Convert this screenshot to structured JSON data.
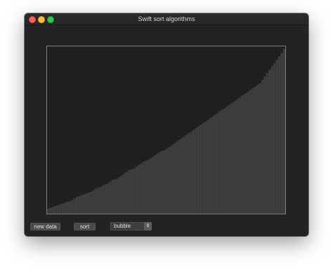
{
  "window": {
    "title": "Swift sort algorithms"
  },
  "controls": {
    "new_data_label": "new data",
    "sort_label": "sort",
    "algorithm": {
      "selected": "bubble",
      "stepper_glyph": "⇕"
    }
  },
  "colors": {
    "bar_fill": "#3d3d3d",
    "bar_edge": "#363636",
    "plot_background": "#1f1f1f",
    "plot_border": "#7d7d7d"
  },
  "chart_data": {
    "type": "bar",
    "order": "ascending",
    "bar_count": 100,
    "ylim": [
      0,
      1
    ],
    "values": [
      0.03,
      0.035,
      0.04,
      0.045,
      0.05,
      0.055,
      0.06,
      0.065,
      0.07,
      0.075,
      0.08,
      0.09,
      0.1,
      0.105,
      0.11,
      0.115,
      0.12,
      0.125,
      0.13,
      0.14,
      0.15,
      0.155,
      0.16,
      0.17,
      0.175,
      0.18,
      0.19,
      0.2,
      0.205,
      0.21,
      0.22,
      0.23,
      0.24,
      0.25,
      0.26,
      0.265,
      0.27,
      0.28,
      0.29,
      0.3,
      0.31,
      0.315,
      0.32,
      0.33,
      0.34,
      0.35,
      0.36,
      0.37,
      0.375,
      0.38,
      0.39,
      0.4,
      0.41,
      0.42,
      0.43,
      0.44,
      0.45,
      0.46,
      0.47,
      0.48,
      0.49,
      0.5,
      0.51,
      0.52,
      0.53,
      0.54,
      0.55,
      0.56,
      0.57,
      0.58,
      0.59,
      0.6,
      0.61,
      0.62,
      0.63,
      0.64,
      0.65,
      0.66,
      0.67,
      0.68,
      0.69,
      0.7,
      0.71,
      0.72,
      0.73,
      0.74,
      0.75,
      0.76,
      0.77,
      0.78,
      0.8,
      0.82,
      0.84,
      0.86,
      0.88,
      0.9,
      0.92,
      0.94,
      0.96,
      0.985
    ]
  }
}
